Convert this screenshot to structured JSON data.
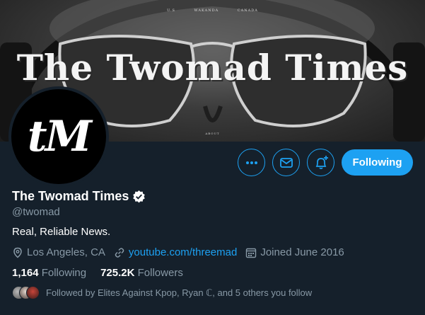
{
  "banner": {
    "nav_items": [
      "U.S",
      "WAKANDA",
      "CANADA"
    ],
    "title": "The Twomad Times",
    "footer_text": "ABOUT"
  },
  "avatar": {
    "text": "tM"
  },
  "actions": {
    "more_icon": "more-horizontal-icon",
    "message_icon": "envelope-icon",
    "notify_icon": "bell-plus-icon",
    "follow_label": "Following"
  },
  "profile": {
    "name": "The Twomad Times",
    "verified_icon": "verified-badge-icon",
    "handle": "@twomad",
    "bio": "Real, Reliable News.",
    "location": "Los Angeles, CA",
    "website": "youtube.com/threemad",
    "joined": "Joined June 2016"
  },
  "stats": {
    "following_count": "1,164",
    "following_label": "Following",
    "followers_count": "725.2K",
    "followers_label": "Followers"
  },
  "followed_by": {
    "text": "Followed by Elites Against Kpop, Ryan ℂ, and 5 others you follow"
  },
  "colors": {
    "background": "#15202b",
    "accent": "#1da1f2",
    "secondary_text": "#8899a6"
  }
}
